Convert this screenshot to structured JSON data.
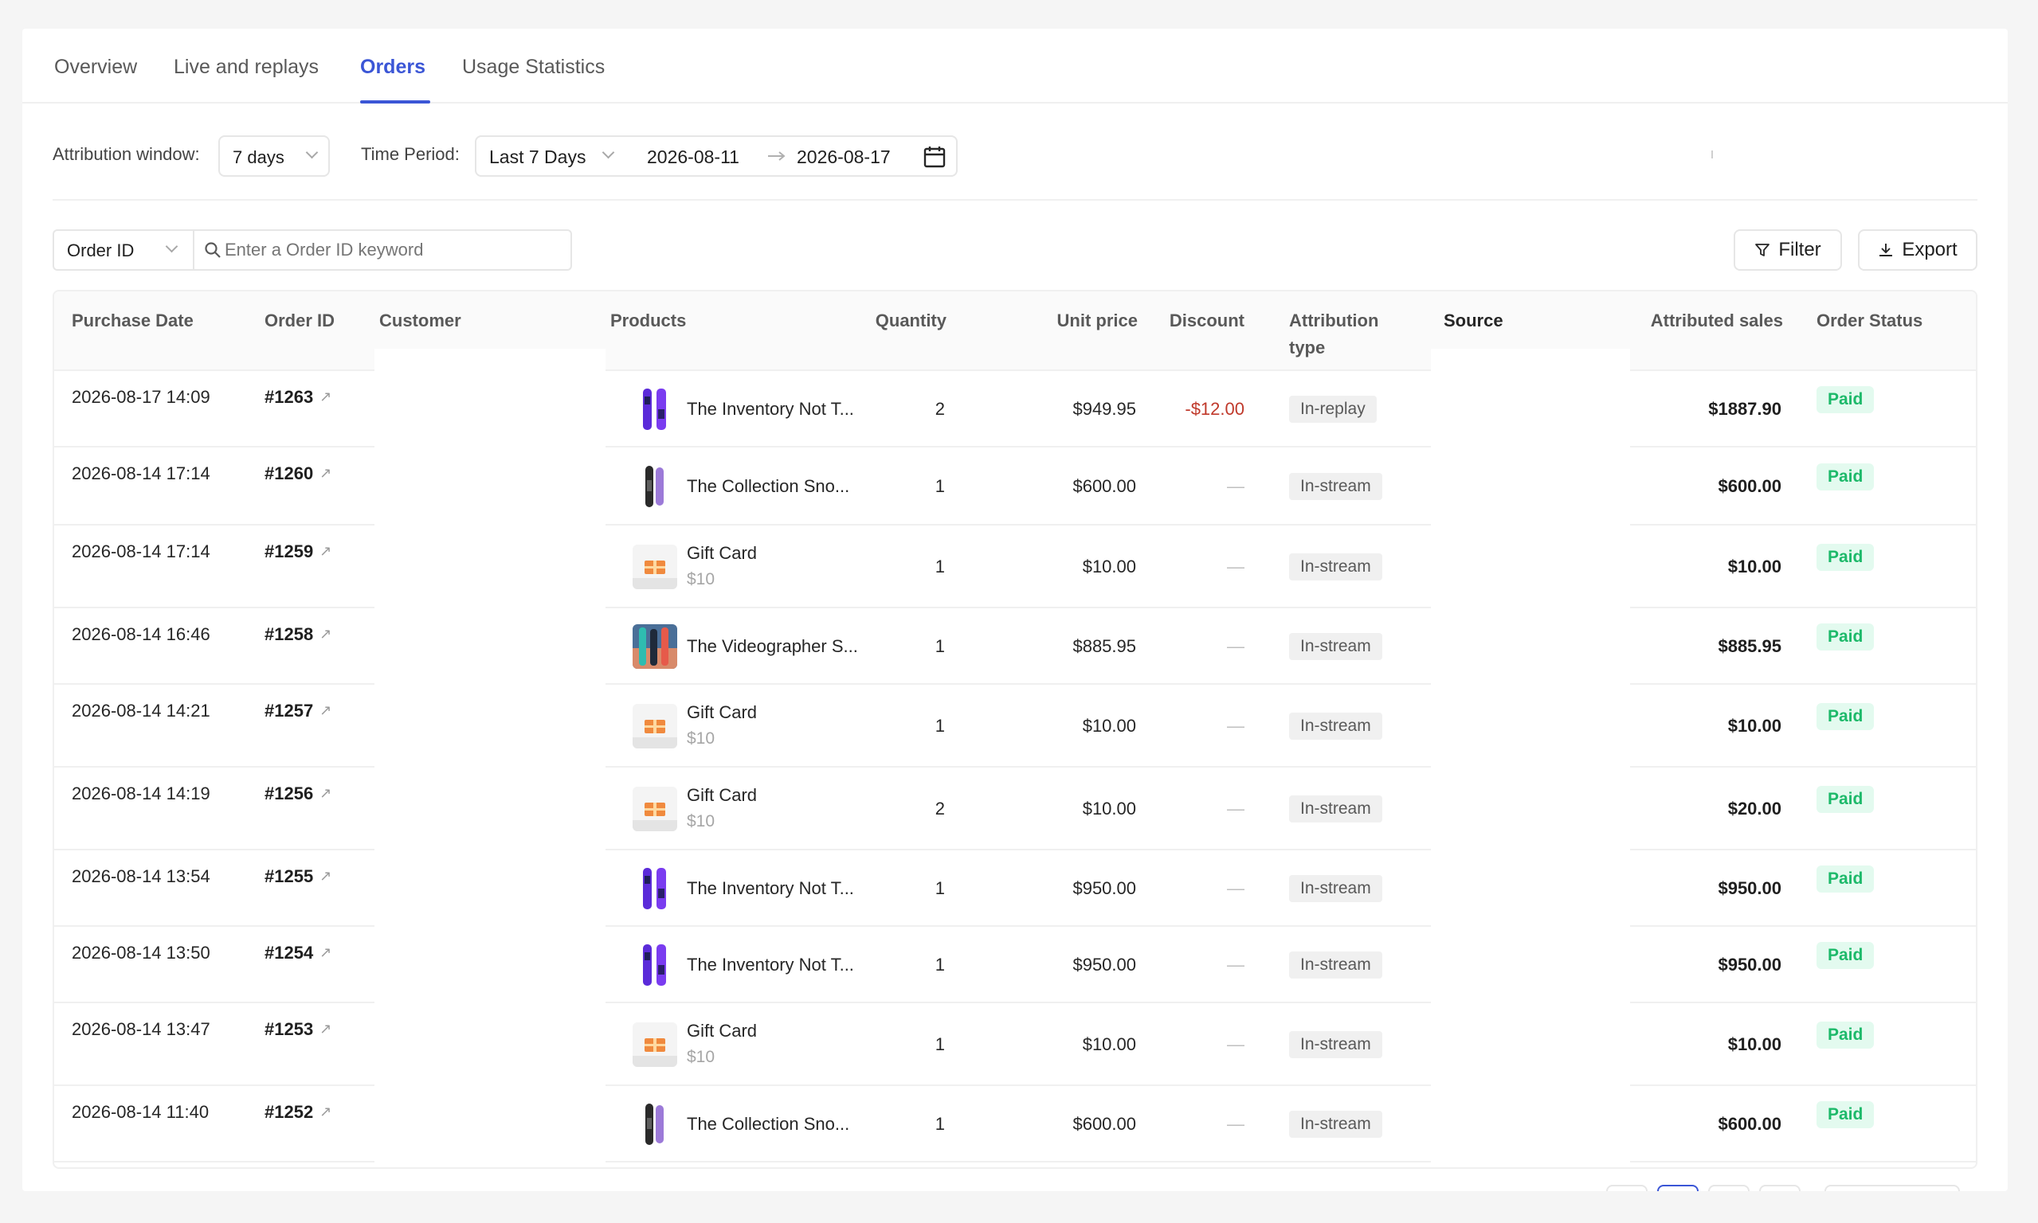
{
  "tabs": [
    {
      "label": "Overview"
    },
    {
      "label": "Live and replays"
    },
    {
      "label": "Orders"
    },
    {
      "label": "Usage Statistics"
    }
  ],
  "filters": {
    "attribution_label": "Attribution window:",
    "attribution_value": "7 days",
    "period_label": "Time Period:",
    "period_value": "Last 7 Days",
    "date_start": "2026-08-11",
    "date_end": "2026-08-17"
  },
  "search": {
    "field": "Order ID",
    "placeholder": "Enter a Order ID keyword"
  },
  "actions": {
    "filter_label": "Filter",
    "export_label": "Export"
  },
  "table": {
    "headers": {
      "purchase_date": "Purchase Date",
      "order_id": "Order ID",
      "customer": "Customer",
      "products": "Products",
      "quantity": "Quantity",
      "unit_price": "Unit price",
      "discount": "Discount",
      "attribution_line1": "Attribution",
      "attribution_line2": "type",
      "source": "Source",
      "attributed_sales": "Attributed sales",
      "order_status": "Order Status"
    },
    "rows": [
      {
        "date": "2026-08-17 14:09",
        "order_id": "#1263",
        "product": "The Inventory Not T...",
        "variant": "",
        "thumb": "purple-snowboard",
        "qty": "2",
        "unit_price": "$949.95",
        "discount": "-$12.00",
        "attr": "In-replay",
        "sales": "$1887.90",
        "status": "Paid"
      },
      {
        "date": "2026-08-14 17:14",
        "order_id": "#1260",
        "product": "The Collection Sno...",
        "variant": "",
        "thumb": "dark-snowboard",
        "qty": "1",
        "unit_price": "$600.00",
        "discount": "—",
        "attr": "In-stream",
        "sales": "$600.00",
        "status": "Paid"
      },
      {
        "date": "2026-08-14 17:14",
        "order_id": "#1259",
        "product": "Gift Card",
        "variant": "$10",
        "thumb": "gift-card",
        "qty": "1",
        "unit_price": "$10.00",
        "discount": "—",
        "attr": "In-stream",
        "sales": "$10.00",
        "status": "Paid"
      },
      {
        "date": "2026-08-14 16:46",
        "order_id": "#1258",
        "product": "The Videographer S...",
        "variant": "",
        "thumb": "photo-snowboard",
        "qty": "1",
        "unit_price": "$885.95",
        "discount": "—",
        "attr": "In-stream",
        "sales": "$885.95",
        "status": "Paid"
      },
      {
        "date": "2026-08-14 14:21",
        "order_id": "#1257",
        "product": "Gift Card",
        "variant": "$10",
        "thumb": "gift-card",
        "qty": "1",
        "unit_price": "$10.00",
        "discount": "—",
        "attr": "In-stream",
        "sales": "$10.00",
        "status": "Paid"
      },
      {
        "date": "2026-08-14 14:19",
        "order_id": "#1256",
        "product": "Gift Card",
        "variant": "$10",
        "thumb": "gift-card",
        "qty": "2",
        "unit_price": "$10.00",
        "discount": "—",
        "attr": "In-stream",
        "sales": "$20.00",
        "status": "Paid"
      },
      {
        "date": "2026-08-14 13:54",
        "order_id": "#1255",
        "product": "The Inventory Not T...",
        "variant": "",
        "thumb": "purple-snowboard",
        "qty": "1",
        "unit_price": "$950.00",
        "discount": "—",
        "attr": "In-stream",
        "sales": "$950.00",
        "status": "Paid"
      },
      {
        "date": "2026-08-14 13:50",
        "order_id": "#1254",
        "product": "The Inventory Not T...",
        "variant": "",
        "thumb": "purple-snowboard",
        "qty": "1",
        "unit_price": "$950.00",
        "discount": "—",
        "attr": "In-stream",
        "sales": "$950.00",
        "status": "Paid"
      },
      {
        "date": "2026-08-14 13:47",
        "order_id": "#1253",
        "product": "Gift Card",
        "variant": "$10",
        "thumb": "gift-card",
        "qty": "1",
        "unit_price": "$10.00",
        "discount": "—",
        "attr": "In-stream",
        "sales": "$10.00",
        "status": "Paid"
      },
      {
        "date": "2026-08-14 11:40",
        "order_id": "#1252",
        "product": "The Collection Sno...",
        "variant": "",
        "thumb": "dark-snowboard",
        "qty": "1",
        "unit_price": "$600.00",
        "discount": "—",
        "attr": "In-stream",
        "sales": "$600.00",
        "status": "Paid"
      }
    ]
  },
  "colors": {
    "accent": "#3b56d6",
    "paid_bg": "#e3faef",
    "paid_text": "#1db96a",
    "discount_text": "#c0392b"
  }
}
